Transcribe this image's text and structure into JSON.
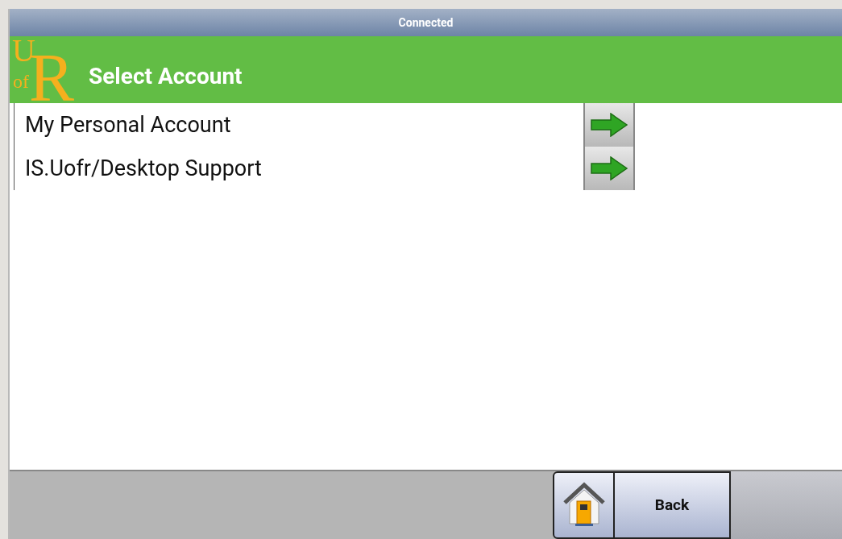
{
  "status_bar": {
    "text": "Connected"
  },
  "header": {
    "logo": {
      "top": "U",
      "small": "of",
      "big": "R"
    },
    "title": "Select Account"
  },
  "accounts": [
    {
      "name": "My Personal Account"
    },
    {
      "name": "IS.Uofr/Desktop Support"
    }
  ],
  "footer": {
    "back_label": "Back"
  }
}
